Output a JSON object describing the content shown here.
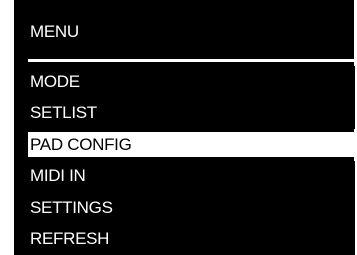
{
  "menu": {
    "title": "MENU",
    "items": [
      {
        "label": "MODE",
        "selected": false
      },
      {
        "label": "SETLIST",
        "selected": false
      },
      {
        "label": "PAD CONFIG",
        "selected": true
      },
      {
        "label": "MIDI IN",
        "selected": false
      },
      {
        "label": "SETTINGS",
        "selected": false
      },
      {
        "label": "REFRESH",
        "selected": false
      }
    ]
  },
  "colors": {
    "background": "#000000",
    "text": "#ffffff",
    "highlight": "#ffffff",
    "highlight_text": "#000000"
  }
}
